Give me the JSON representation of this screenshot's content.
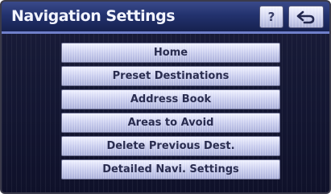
{
  "header": {
    "title": "Navigation Settings",
    "help_label": "?",
    "help_icon": "question-mark-icon",
    "back_icon": "return-arrow-icon"
  },
  "menu": {
    "items": [
      {
        "label": "Home"
      },
      {
        "label": "Preset Destinations"
      },
      {
        "label": "Address Book"
      },
      {
        "label": "Areas to Avoid"
      },
      {
        "label": "Delete Previous Dest."
      },
      {
        "label": "Detailed Navi. Settings"
      }
    ]
  },
  "colors": {
    "header_bg": "#23326e",
    "header_border": "#6f7fc9",
    "screen_bg": "#141733",
    "button_face": "#c9cdee",
    "button_text": "#2a2d50"
  }
}
